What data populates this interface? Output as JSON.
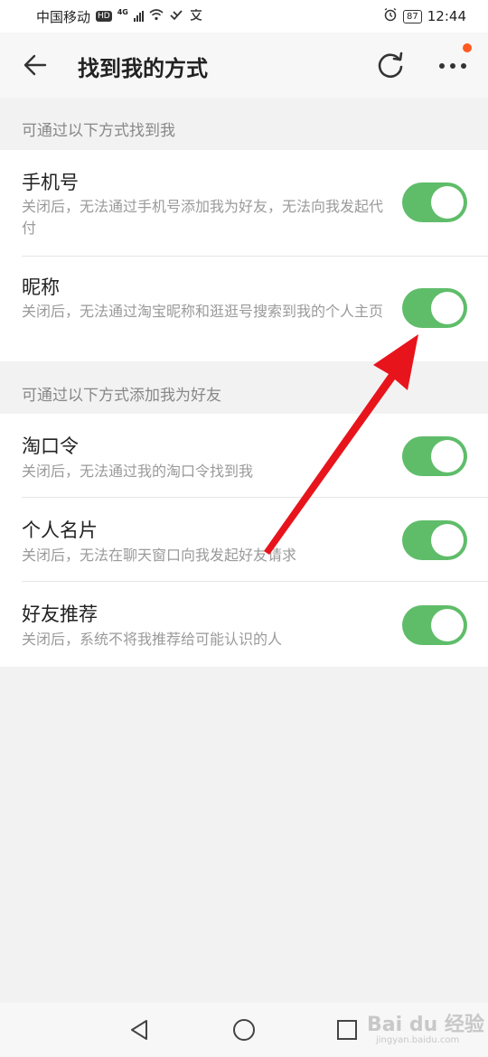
{
  "status_bar": {
    "carrier": "中国移动",
    "hd_badge": "HD",
    "network_type": "4G",
    "battery": "87",
    "time": "12:44"
  },
  "header": {
    "title": "找到我的方式"
  },
  "sections": [
    {
      "header": "可通过以下方式找到我",
      "items": [
        {
          "title": "手机号",
          "desc": "关闭后，无法通过手机号添加我为好友，无法向我发起代付",
          "enabled": true
        },
        {
          "title": "昵称",
          "desc": "关闭后，无法通过淘宝昵称和逛逛号搜索到我的个人主页",
          "enabled": true
        }
      ]
    },
    {
      "header": "可通过以下方式添加我为好友",
      "items": [
        {
          "title": "淘口令",
          "desc": "关闭后，无法通过我的淘口令找到我",
          "enabled": true
        },
        {
          "title": "个人名片",
          "desc": "关闭后，无法在聊天窗口向我发起好友请求",
          "enabled": true
        },
        {
          "title": "好友推荐",
          "desc": "关闭后，系统不将我推荐给可能认识的人",
          "enabled": true
        }
      ]
    }
  ],
  "watermark": {
    "brand": "Bai du 经验",
    "url": "jingyan.baidu.com"
  },
  "colors": {
    "toggle_on": "#5fbd6a",
    "notification_dot": "#ff5a1f",
    "annotation_arrow": "#e8141c"
  }
}
